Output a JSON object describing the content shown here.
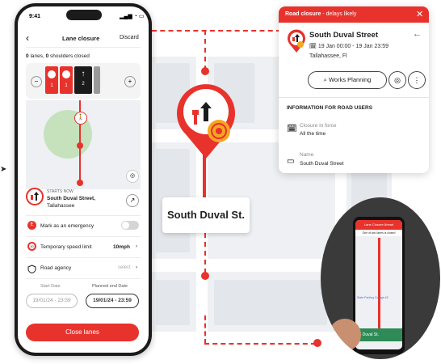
{
  "phone": {
    "status_time": "9:41",
    "status_icons": "signal-wifi-battery",
    "header": {
      "back_icon": "chevron-left-icon",
      "title": "Lane closure",
      "discard": "Discard"
    },
    "lanes_summary": {
      "lanes_count": "0",
      "lanes_text": "lanes,",
      "shoulders_count": "0",
      "shoulders_text": "shoulders closed"
    },
    "lane_stepper": {
      "minus": "−",
      "plus": "+",
      "lane_numbers": [
        "1",
        "1",
        "2"
      ]
    },
    "card": {
      "starts": "STARTS NOW",
      "address_line1": "South Duval Street,",
      "address_line2": "Tallahassee"
    },
    "rows": [
      {
        "label": "Mark as an emergency",
        "value": "",
        "control": "toggle"
      },
      {
        "label": "Temporary speed limit",
        "value": "10mph",
        "control": "chevron"
      },
      {
        "label": "Road agency",
        "value": "select",
        "control": "chevron"
      }
    ],
    "dates": {
      "start_label": "Start Date",
      "end_label": "Planned end Date",
      "start_value": "19/01/24 - 23:59",
      "end_value": "19/01/24 - 23:59"
    },
    "close_button": "Close lanes"
  },
  "notification": {
    "header_bold": "Road closure",
    "header_rest": " - delays likely",
    "close_icon": "close-icon",
    "street": "South Duval Street",
    "dates": "19 Jan 00:00 - 19 Jan 23:59",
    "city": "Tallahassee, Fl",
    "works_button": "Works Planning",
    "section_title": "INFORMATION FOR ROAD USERS",
    "info": [
      {
        "label": "Closure in force",
        "value": "All the time"
      },
      {
        "label": "Name",
        "value": "South Duval Street"
      }
    ]
  },
  "map_label": "South Duval St.",
  "car_screen": {
    "header": "Lane Closure Ahead",
    "sub": "One of two lanes is closed",
    "street": "S Duval St.",
    "place": "State Parking Garage #3"
  },
  "colors": {
    "accent": "#e8322c",
    "dark": "#1b1b1b",
    "map": "#eef0f3"
  }
}
